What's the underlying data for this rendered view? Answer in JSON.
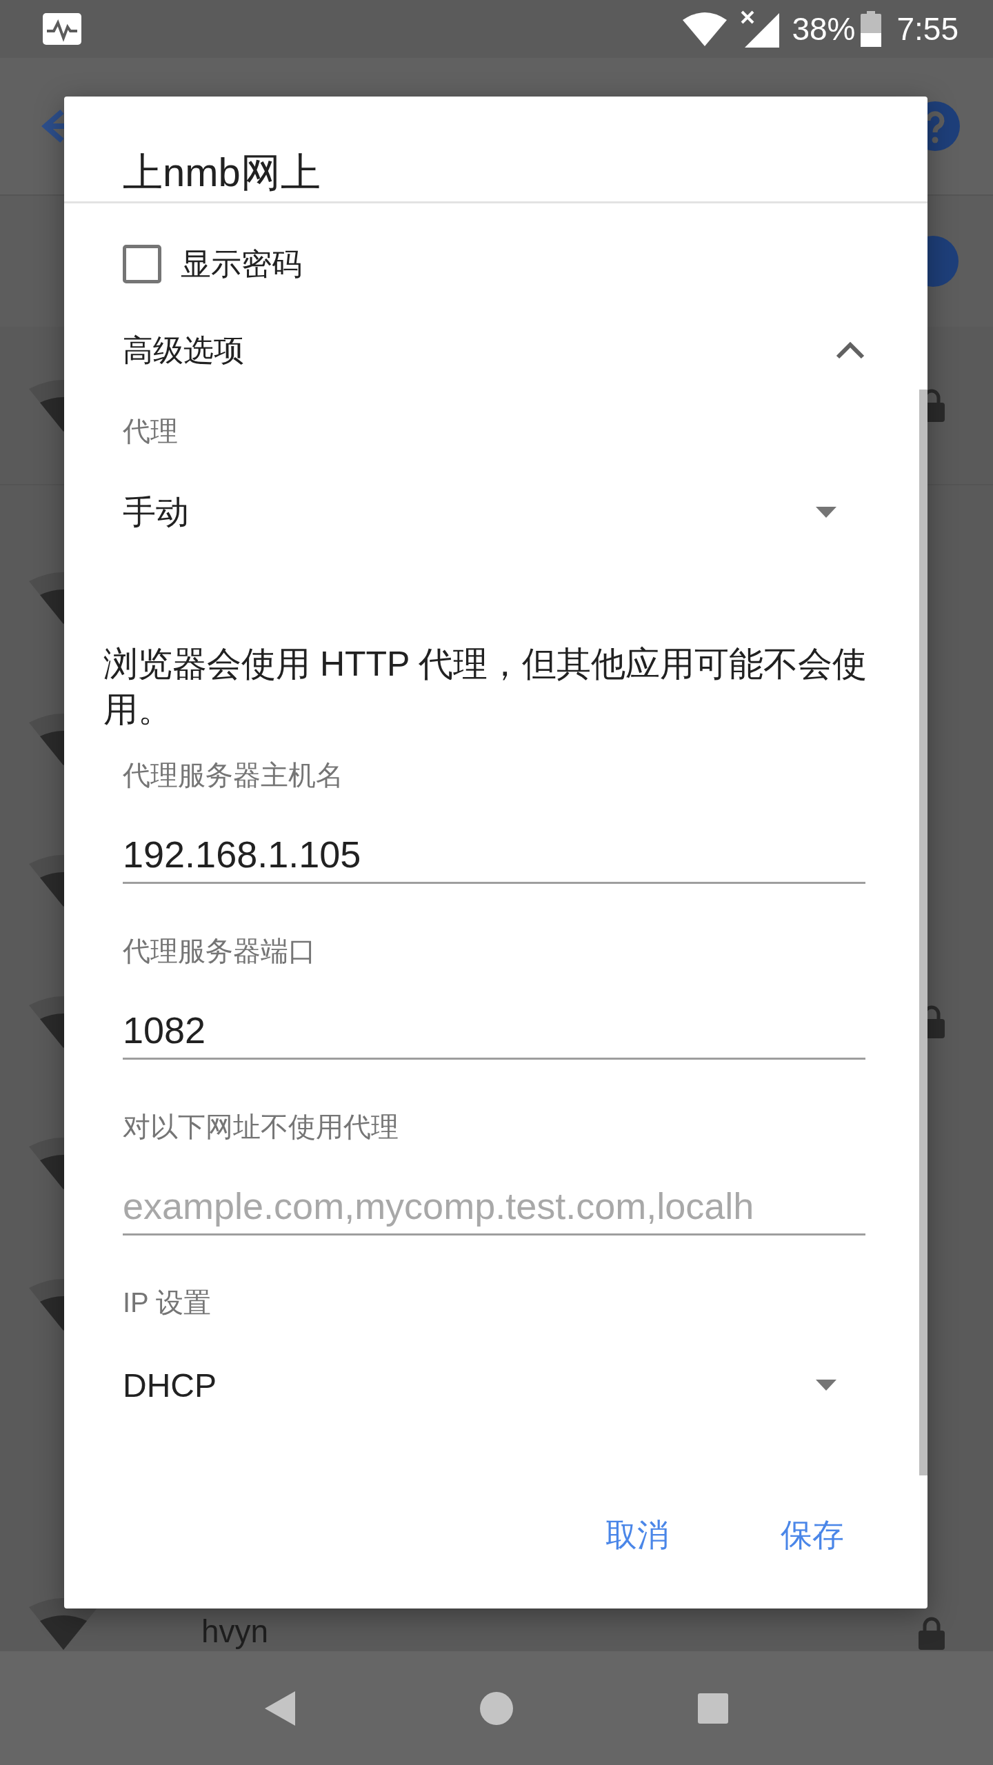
{
  "status_bar": {
    "battery": "38%",
    "time": "7:55"
  },
  "background": {
    "wifi_toggle": {
      "on": true
    },
    "rows": [
      {
        "locked": true
      },
      {
        "locked": false
      },
      {
        "locked": false
      },
      {
        "locked": false
      },
      {
        "locked": true
      },
      {
        "locked": false
      },
      {
        "locked": false
      },
      {
        "name": "hvyn",
        "locked": true
      }
    ]
  },
  "dialog": {
    "title": "上nmb网上",
    "show_password": {
      "label": "显示密码",
      "checked": false
    },
    "advanced": {
      "label": "高级选项",
      "expanded": true
    },
    "proxy": {
      "label": "代理",
      "value": "手动"
    },
    "proxy_note": "浏览器会使用 HTTP 代理，但其他应用可能不会使用。",
    "fields": [
      {
        "label": "代理服务器主机名",
        "value": "192.168.1.105"
      },
      {
        "label": "代理服务器端口",
        "value": "1082"
      },
      {
        "label": "对以下网址不使用代理",
        "placeholder": "example.com,mycomp.test.com,localh"
      }
    ],
    "ip_settings": {
      "label": "IP 设置",
      "value": "DHCP"
    },
    "buttons": [
      "取消",
      "保存"
    ]
  }
}
